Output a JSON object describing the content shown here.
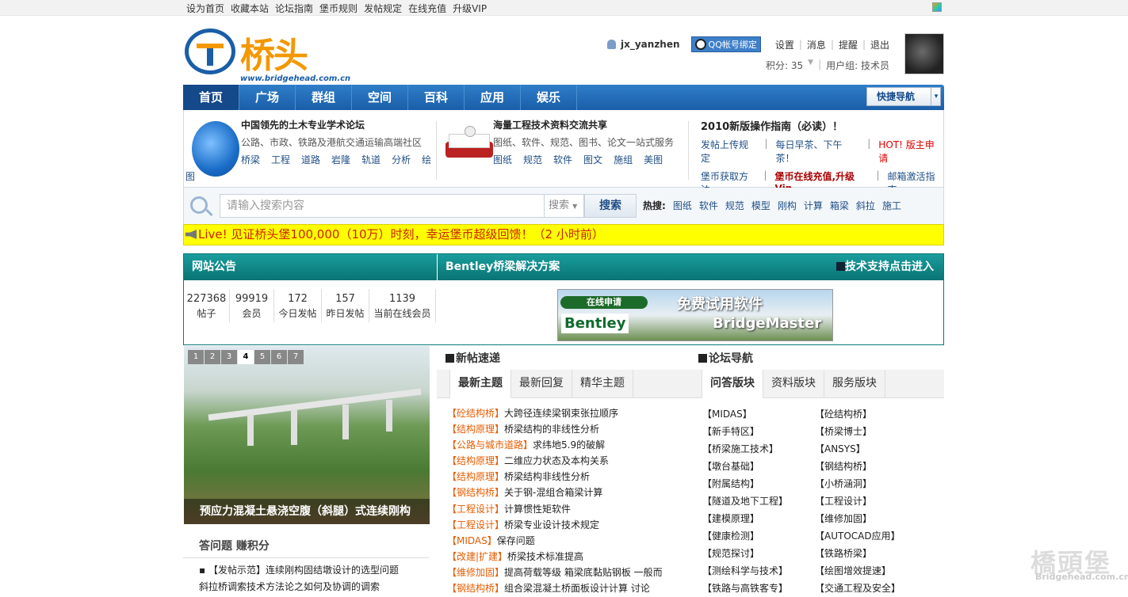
{
  "topbar": {
    "links": [
      "设为首页",
      "收藏本站",
      "论坛指南",
      "堡币规则",
      "发帖规定",
      "在线充值",
      "升级VIP"
    ]
  },
  "logo": {
    "name": "桥头堡",
    "url": "www.bridgehead.com.cn"
  },
  "user": {
    "name": "jx_yanzhen",
    "qq_bind": "QQ帐号绑定",
    "links": [
      "设置",
      "消息",
      "提醒",
      "退出"
    ],
    "points": "积分: 35",
    "group": "用户组: 技术员"
  },
  "nav": {
    "items": [
      "首页",
      "广场",
      "群组",
      "空间",
      "百科",
      "应用",
      "娱乐"
    ],
    "quick": "快捷导航"
  },
  "info": {
    "box1": {
      "title": "中国领先的土木专业学术论坛",
      "sub": "公路、市政、铁路及港航交通运输高端社区",
      "links": [
        "桥梁",
        "工程",
        "道路",
        "岩隆",
        "轨道",
        "分析",
        "绘"
      ],
      "tail": "图"
    },
    "box2": {
      "title": "海量工程技术资料交流共享",
      "sub": "图纸、软件、规范、图书、论文一站式服务",
      "links": [
        "图纸",
        "规范",
        "软件",
        "图文",
        "施组",
        "美图"
      ]
    },
    "box3": {
      "title": "2010新版操作指南（必读）！",
      "row1": [
        "发帖上传规定",
        "每日早茶、下午茶！",
        "HOT! 版主申请"
      ],
      "row2": [
        "堡币获取方法",
        "堡币在线充值,升级Vip",
        "邮箱激活指南"
      ]
    }
  },
  "search": {
    "placeholder": "请输入搜索内容",
    "select": "搜索",
    "button": "搜索",
    "hot_label": "热搜:",
    "hot": [
      "图纸",
      "软件",
      "规范",
      "模型",
      "刚构",
      "计算",
      "箱梁",
      "斜拉",
      "施工"
    ]
  },
  "ticker": "Live! 见证桥头堡100,000（10万）时刻，幸运堡币超级回馈！（2 小时前）",
  "notice": {
    "title": "网站公告",
    "bentley": "Bentley桥梁解决方案",
    "support": "技术支持点击进入",
    "stats": [
      {
        "n": "227368",
        "l": "帖子"
      },
      {
        "n": "99919",
        "l": "会员"
      },
      {
        "n": "172",
        "l": "今日发帖"
      },
      {
        "n": "157",
        "l": "昨日发帖"
      },
      {
        "n": "1139",
        "l": "当前在线会员"
      }
    ],
    "banner": {
      "apply": "在线申请",
      "brand": "Bentley",
      "free": "免费试用软件",
      "product": "BridgeMaster"
    }
  },
  "slider": {
    "pages": [
      "1",
      "2",
      "3",
      "4",
      "5",
      "6",
      "7"
    ],
    "current": "4",
    "caption": "预应力混凝土悬浇空腹（斜腿）式连续刚构"
  },
  "qa": {
    "title": "答问题 赚积分",
    "items": [
      "【发帖示范】连续刚构固结墩设计的选型问题",
      "斜拉桥调索技术方法论之如何及协调的调索"
    ]
  },
  "newposts": {
    "title": "新帖速递",
    "tabs": [
      "最新主题",
      "最新回复",
      "精华主题"
    ],
    "items": [
      {
        "cat": "【砼结构桥】",
        "title": "大跨径连续梁钢束张拉顺序"
      },
      {
        "cat": "【结构原理】",
        "title": "桥梁结构的非线性分析"
      },
      {
        "cat": "【公路与城市道路】",
        "title": "求纬地5.9的破解"
      },
      {
        "cat": "【结构原理】",
        "title": "二维应力状态及本构关系"
      },
      {
        "cat": "【结构原理】",
        "title": "桥梁结构非线性分析"
      },
      {
        "cat": "【钢结构桥】",
        "title": "关于钢-混组合箱梁计算"
      },
      {
        "cat": "【工程设计】",
        "title": "计算惯性矩软件"
      },
      {
        "cat": "【工程设计】",
        "title": "桥梁专业设计技术规定"
      },
      {
        "cat": "【MIDAS】",
        "title": "保存问题"
      },
      {
        "cat": "【改建|扩建】",
        "title": "桥梁技术标准提高"
      },
      {
        "cat": "【维修加固】",
        "title": "提高荷载等级 箱梁底黏贴钢板 一般而"
      },
      {
        "cat": "【钢结构桥】",
        "title": "组合梁混凝土桥面板设计计算 讨论"
      }
    ]
  },
  "forumnav": {
    "title": "论坛导航",
    "tabs": [
      "问答版块",
      "资料版块",
      "服务版块"
    ],
    "col1": [
      "【MIDAS】",
      "【新手特区】",
      "【桥梁施工技术】",
      "【墩台基础】",
      "【附属结构】",
      "【隧道及地下工程】",
      "【建模原理】",
      "【健康检测】",
      "【规范探讨】",
      "【测绘科学与技术】",
      "【铁路与高铁客专】"
    ],
    "col2": [
      "【砼结构桥】",
      "【桥梁博士】",
      "【ANSYS】",
      "【钢结构桥】",
      "【小桥涵洞】",
      "【工程设计】",
      "【维修加固】",
      "【AUTOCAD应用】",
      "【铁路桥梁】",
      "【绘图增效提速】",
      "【交通工程及安全】"
    ]
  },
  "watermark": {
    "text": "橋頭堡",
    "url": "Bridgehead.com.cn"
  }
}
